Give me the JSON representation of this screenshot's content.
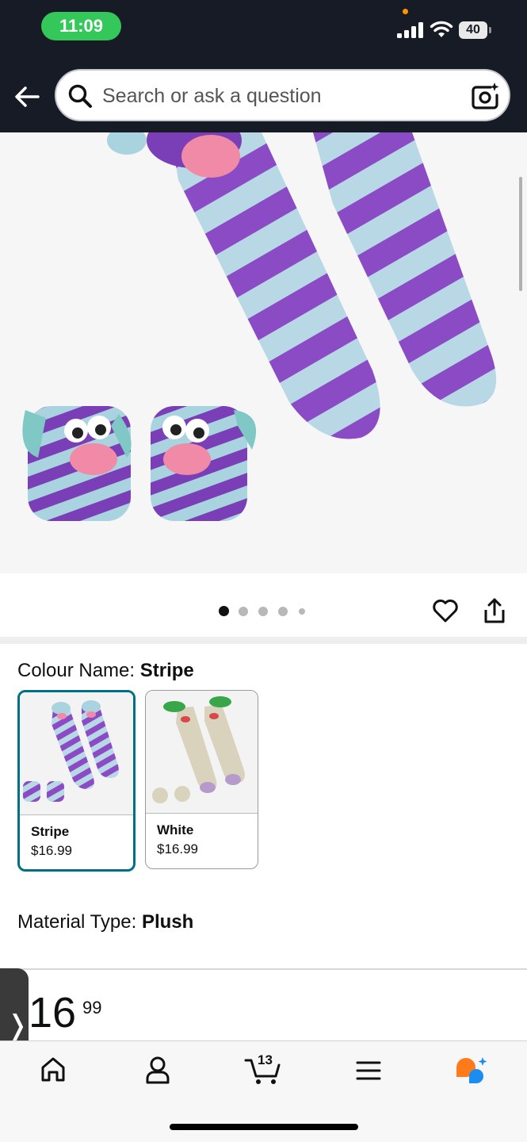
{
  "status_bar": {
    "time": "11:09",
    "battery_level": "40",
    "icons": [
      "signal-icon",
      "wifi-icon",
      "battery-icon"
    ]
  },
  "search": {
    "placeholder": "Search or ask a question",
    "icons": [
      "back-arrow-icon",
      "search-icon",
      "camera-search-icon"
    ]
  },
  "gallery": {
    "image_count": 5,
    "active_index": 0,
    "icons": [
      "heart-icon",
      "share-icon"
    ]
  },
  "colour": {
    "label": "Colour Name:",
    "value": "Stripe",
    "options": [
      {
        "name": "Stripe",
        "price": "$16.99",
        "selected": true
      },
      {
        "name": "White",
        "price": "$16.99",
        "selected": false
      }
    ]
  },
  "material": {
    "label": "Material Type:",
    "value": "Plush"
  },
  "price": {
    "whole": "16",
    "fraction": "99"
  },
  "side_tab": {
    "label": "❭"
  },
  "bottom_nav": {
    "cart_count": "13",
    "icons": [
      "home-icon",
      "account-icon",
      "cart-icon",
      "menu-icon",
      "rufus-ai-icon"
    ]
  },
  "colors": {
    "header_bg": "#161b26",
    "selected_border": "#007185",
    "time_pill": "#34c759",
    "ai_orange": "#ff7a1a",
    "ai_blue": "#1b8df0"
  }
}
